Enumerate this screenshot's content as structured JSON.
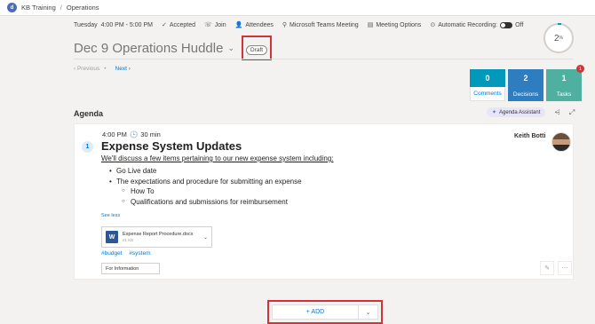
{
  "breadcrumb": {
    "app": "KB Training",
    "separator": "/",
    "current": "Operations"
  },
  "meeting": {
    "day": "Tuesday",
    "time_range": "4:00 PM - 5:00 PM",
    "status": "Accepted",
    "join": "Join",
    "attendees": "Attendees",
    "location": "Microsoft Teams Meeting",
    "options": "Meeting Options",
    "recording_label": "Automatic Recording:",
    "recording_state": "Off",
    "title": "Dec 9 Operations Huddle",
    "draft": "Draft",
    "progress": "2",
    "progress_unit": "%"
  },
  "pager": {
    "previous": "‹ Previous",
    "next": "Next ›"
  },
  "stats": [
    {
      "value": "0",
      "label": "Comments",
      "color": "#0099bc"
    },
    {
      "value": "2",
      "label": "Decisions",
      "color": "#2d7dc0"
    },
    {
      "value": "1",
      "label": "Tasks",
      "color": "#4fb0a2",
      "badge": "1"
    }
  ],
  "agenda": {
    "heading": "Agenda",
    "assistant": "Agenda Assistant",
    "item": {
      "time": "4:00 PM",
      "duration": "30 min",
      "number": "1",
      "title": "Expense System Updates",
      "presenter": "Keith Botti",
      "description": "We'll discuss a few items pertaining to our new expense system including:",
      "bullets": [
        "Go Live date",
        "The expectations and procedure for submitting an expense",
        "How To",
        "Qualifications and submissions for reimbursement"
      ],
      "see_less": "See less",
      "attachment": {
        "name": "Expense Report Procedure.docx",
        "size": "21 KB",
        "icon_letter": "W"
      },
      "tags": [
        "#budget",
        "#system"
      ],
      "type": "For Information"
    }
  },
  "add_button": {
    "label": "+ ADD"
  },
  "colors": {
    "accent": "#0078d4",
    "highlight": "#d13438"
  }
}
